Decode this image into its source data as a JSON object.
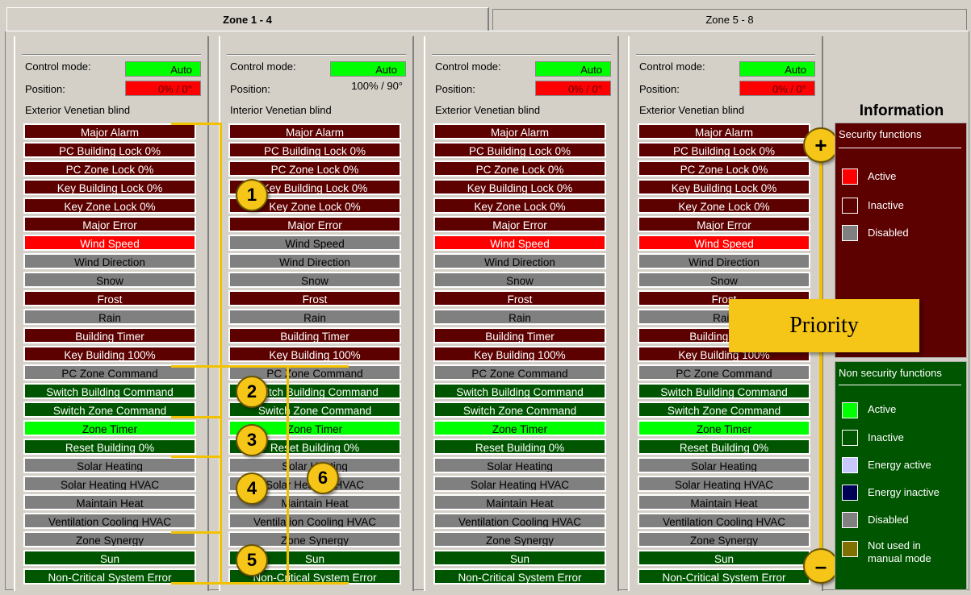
{
  "tabs": [
    {
      "label": "Zone 1 - 4"
    },
    {
      "label": "Zone 5 - 8"
    }
  ],
  "columns": [
    {
      "control_label": "Control mode:",
      "control_value": "Auto",
      "position_label": "Position:",
      "position_value": "0% / 0°",
      "position_style": "red",
      "type": "Exterior Venetian blind"
    },
    {
      "control_label": "Control mode:",
      "control_value": "Auto",
      "position_label": "Position:",
      "position_value": "100% / 90°",
      "position_style": "plain",
      "type": "Interior Venetian blind"
    },
    {
      "control_label": "Control mode:",
      "control_value": "Auto",
      "position_label": "Position:",
      "position_value": "0% / 0°",
      "position_style": "red",
      "type": "Exterior Venetian blind"
    },
    {
      "control_label": "Control mode:",
      "control_value": "Auto",
      "position_label": "Position:",
      "position_value": "0% / 0°",
      "position_style": "red",
      "type": "Exterior Venetian blind"
    }
  ],
  "functions": [
    "Major Alarm",
    "PC Building Lock 0%",
    "PC Zone Lock 0%",
    "Key Building Lock 0%",
    "Key Zone Lock 0%",
    "Major Error",
    "Wind Speed",
    "Wind Direction",
    "Snow",
    "Frost",
    "Rain",
    "Building Timer",
    "Key Building 100%",
    "PC Zone Command",
    "Switch Building Command",
    "Switch Zone Command",
    "Zone Timer",
    "Reset Building 0%",
    "Solar Heating",
    "Solar Heating HVAC",
    "Maintain Heat",
    "Ventilation Cooling HVAC",
    "Zone Synergy",
    "Sun",
    "Non-Critical System Error"
  ],
  "row_states": [
    [
      "maroon",
      "maroon",
      "maroon",
      "maroon",
      "maroon",
      "maroon",
      "red",
      "grey",
      "grey",
      "maroon",
      "grey",
      "maroon",
      "maroon",
      "grey",
      "green",
      "green",
      "bright",
      "green",
      "grey",
      "grey",
      "grey",
      "grey",
      "grey",
      "green",
      "green"
    ],
    [
      "maroon",
      "maroon",
      "maroon",
      "maroon",
      "maroon",
      "maroon",
      "grey",
      "grey",
      "grey",
      "maroon",
      "grey",
      "maroon",
      "maroon",
      "grey",
      "green",
      "green",
      "bright",
      "green",
      "grey",
      "grey",
      "grey",
      "grey",
      "grey",
      "green",
      "green"
    ],
    [
      "maroon",
      "maroon",
      "maroon",
      "maroon",
      "maroon",
      "maroon",
      "red",
      "grey",
      "grey",
      "maroon",
      "grey",
      "maroon",
      "maroon",
      "grey",
      "green",
      "green",
      "bright",
      "green",
      "grey",
      "grey",
      "grey",
      "grey",
      "grey",
      "green",
      "green"
    ],
    [
      "maroon",
      "maroon",
      "maroon",
      "maroon",
      "maroon",
      "maroon",
      "red",
      "grey",
      "grey",
      "maroon",
      "grey",
      "maroon",
      "maroon",
      "grey",
      "green",
      "green",
      "bright",
      "green",
      "grey",
      "grey",
      "grey",
      "grey",
      "grey",
      "green",
      "green"
    ]
  ],
  "badges": [
    "1",
    "2",
    "3",
    "4",
    "5",
    "6"
  ],
  "priority": {
    "label": "Priority",
    "plus": "+",
    "minus": "–"
  },
  "info": {
    "title": "Information",
    "security": {
      "title": "Security functions",
      "items": [
        {
          "label": "Active",
          "color": "#ff0000"
        },
        {
          "label": "Inactive",
          "color": "#5c0000"
        },
        {
          "label": "Disabled",
          "color": "#808080"
        }
      ]
    },
    "non_security": {
      "title": "Non security functions",
      "items": [
        {
          "label": "Active",
          "color": "#00ff00"
        },
        {
          "label": "Inactive",
          "color": "#005500"
        },
        {
          "label": "Energy active",
          "color": "#c8c8ff"
        },
        {
          "label": "Energy inactive",
          "color": "#000055"
        },
        {
          "label": "Disabled",
          "color": "#808080"
        },
        {
          "label": "Not used in manual mode",
          "color": "#807000"
        }
      ]
    }
  }
}
